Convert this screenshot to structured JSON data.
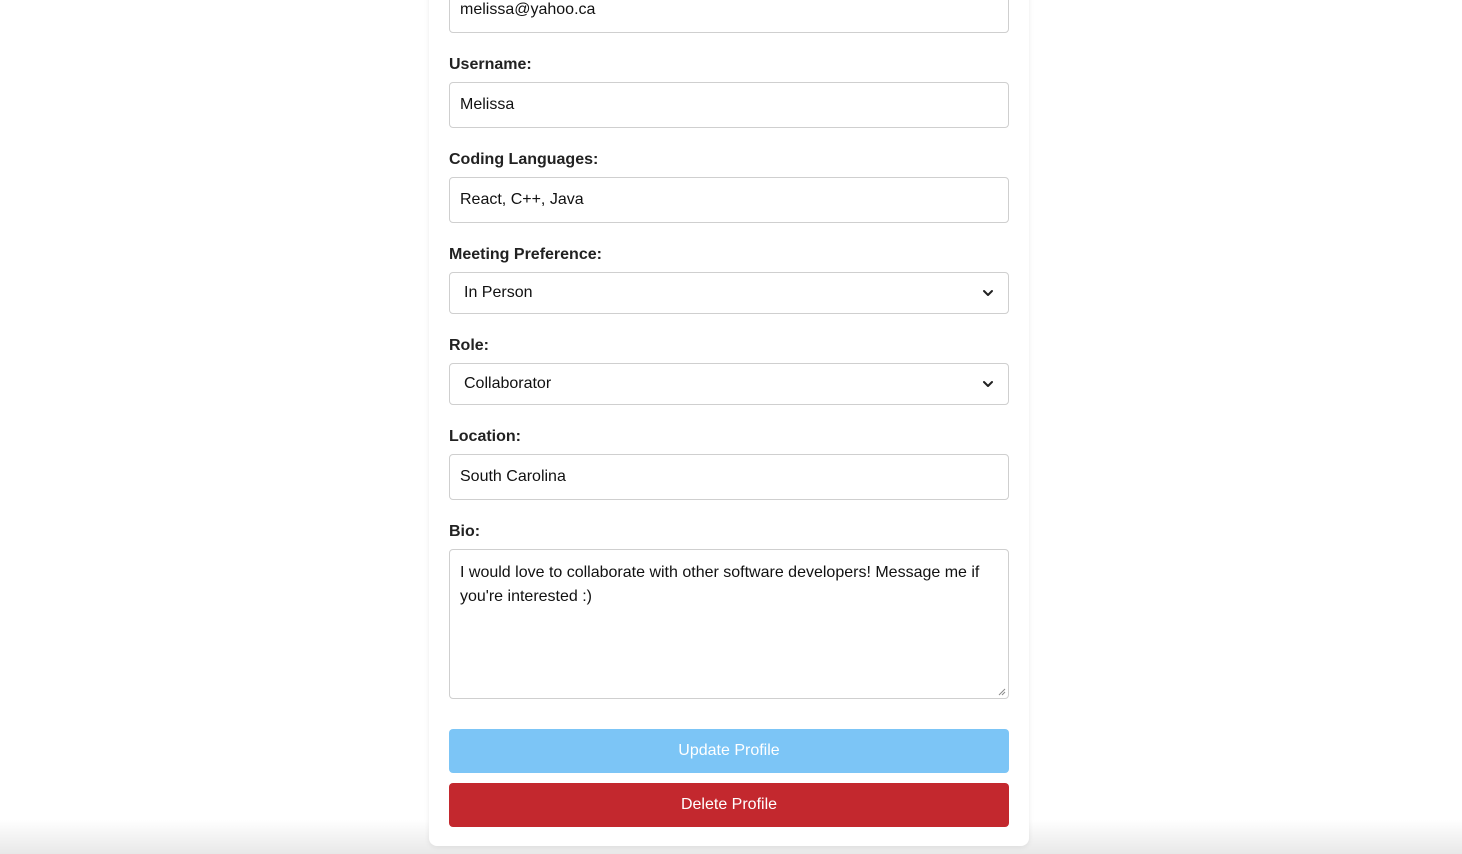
{
  "form": {
    "email": {
      "value": "melissa@yahoo.ca"
    },
    "username": {
      "label": "Username:",
      "value": "Melissa"
    },
    "coding_languages": {
      "label": "Coding Languages:",
      "value": "React, C++, Java"
    },
    "meeting_preference": {
      "label": "Meeting Preference:",
      "selected": "In Person"
    },
    "role": {
      "label": "Role:",
      "selected": "Collaborator"
    },
    "location": {
      "label": "Location:",
      "value": "South Carolina"
    },
    "bio": {
      "label": "Bio:",
      "value": "I would love to collaborate with other software developers! Message me if you're interested :)"
    }
  },
  "buttons": {
    "update_label": "Update Profile",
    "delete_label": "Delete Profile"
  },
  "colors": {
    "update_button": "#7cc5f6",
    "delete_button": "#c3282e",
    "border": "#cfcfcf"
  },
  "icons": {
    "select_chevron": "chevron-down-icon",
    "textarea_resize": "resize-handle-icon"
  }
}
